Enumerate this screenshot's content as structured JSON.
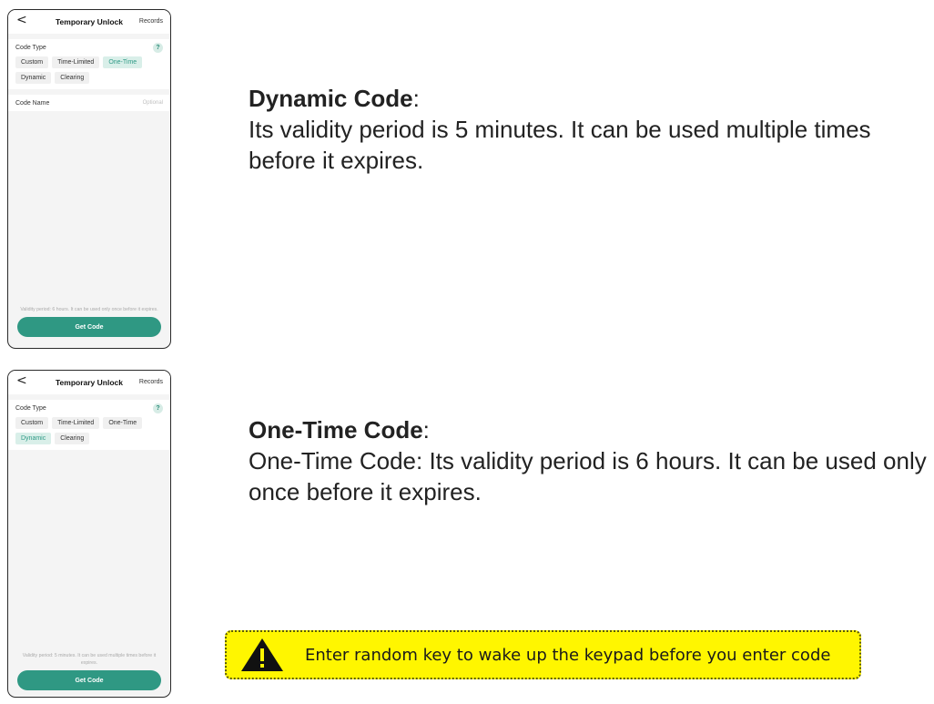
{
  "screens": [
    {
      "nav": {
        "back": "<",
        "title": "Temporary Unlock",
        "records": "Records"
      },
      "code_type_label": "Code Type",
      "help": "?",
      "chips": [
        "Custom",
        "Time-Limited",
        "One-Time",
        "Dynamic",
        "Clearing"
      ],
      "active_chip": "One-Time",
      "code_name_label": "Code Name",
      "code_name_placeholder": "Optional",
      "hint": "Validity period: 6 hours. It can be used only once before it expires.",
      "button": "Get Code"
    },
    {
      "nav": {
        "back": "<",
        "title": "Temporary Unlock",
        "records": "Records"
      },
      "code_type_label": "Code Type",
      "help": "?",
      "chips": [
        "Custom",
        "Time-Limited",
        "One-Time",
        "Dynamic",
        "Clearing"
      ],
      "active_chip": "Dynamic",
      "hint": "Validity period: 5 minutes. It can be used multiple times before it expires.",
      "button": "Get Code"
    }
  ],
  "descriptions": {
    "dynamic": {
      "heading": "Dynamic Code",
      "colon": ":",
      "text": "Its validity period is 5 minutes. It can be used multiple times before it expires."
    },
    "one_time": {
      "heading": "One-Time Code",
      "colon": ":",
      "text": "One-Time Code: Its validity period is 6 hours. It can be used only once before it expires."
    }
  },
  "warning": {
    "icon": "warning-icon",
    "text": "Enter random key to wake up the keypad before you enter code"
  },
  "colors": {
    "accent": "#2f9883",
    "active_chip_bg": "#d9efe9",
    "warning_bg": "#fff600"
  }
}
